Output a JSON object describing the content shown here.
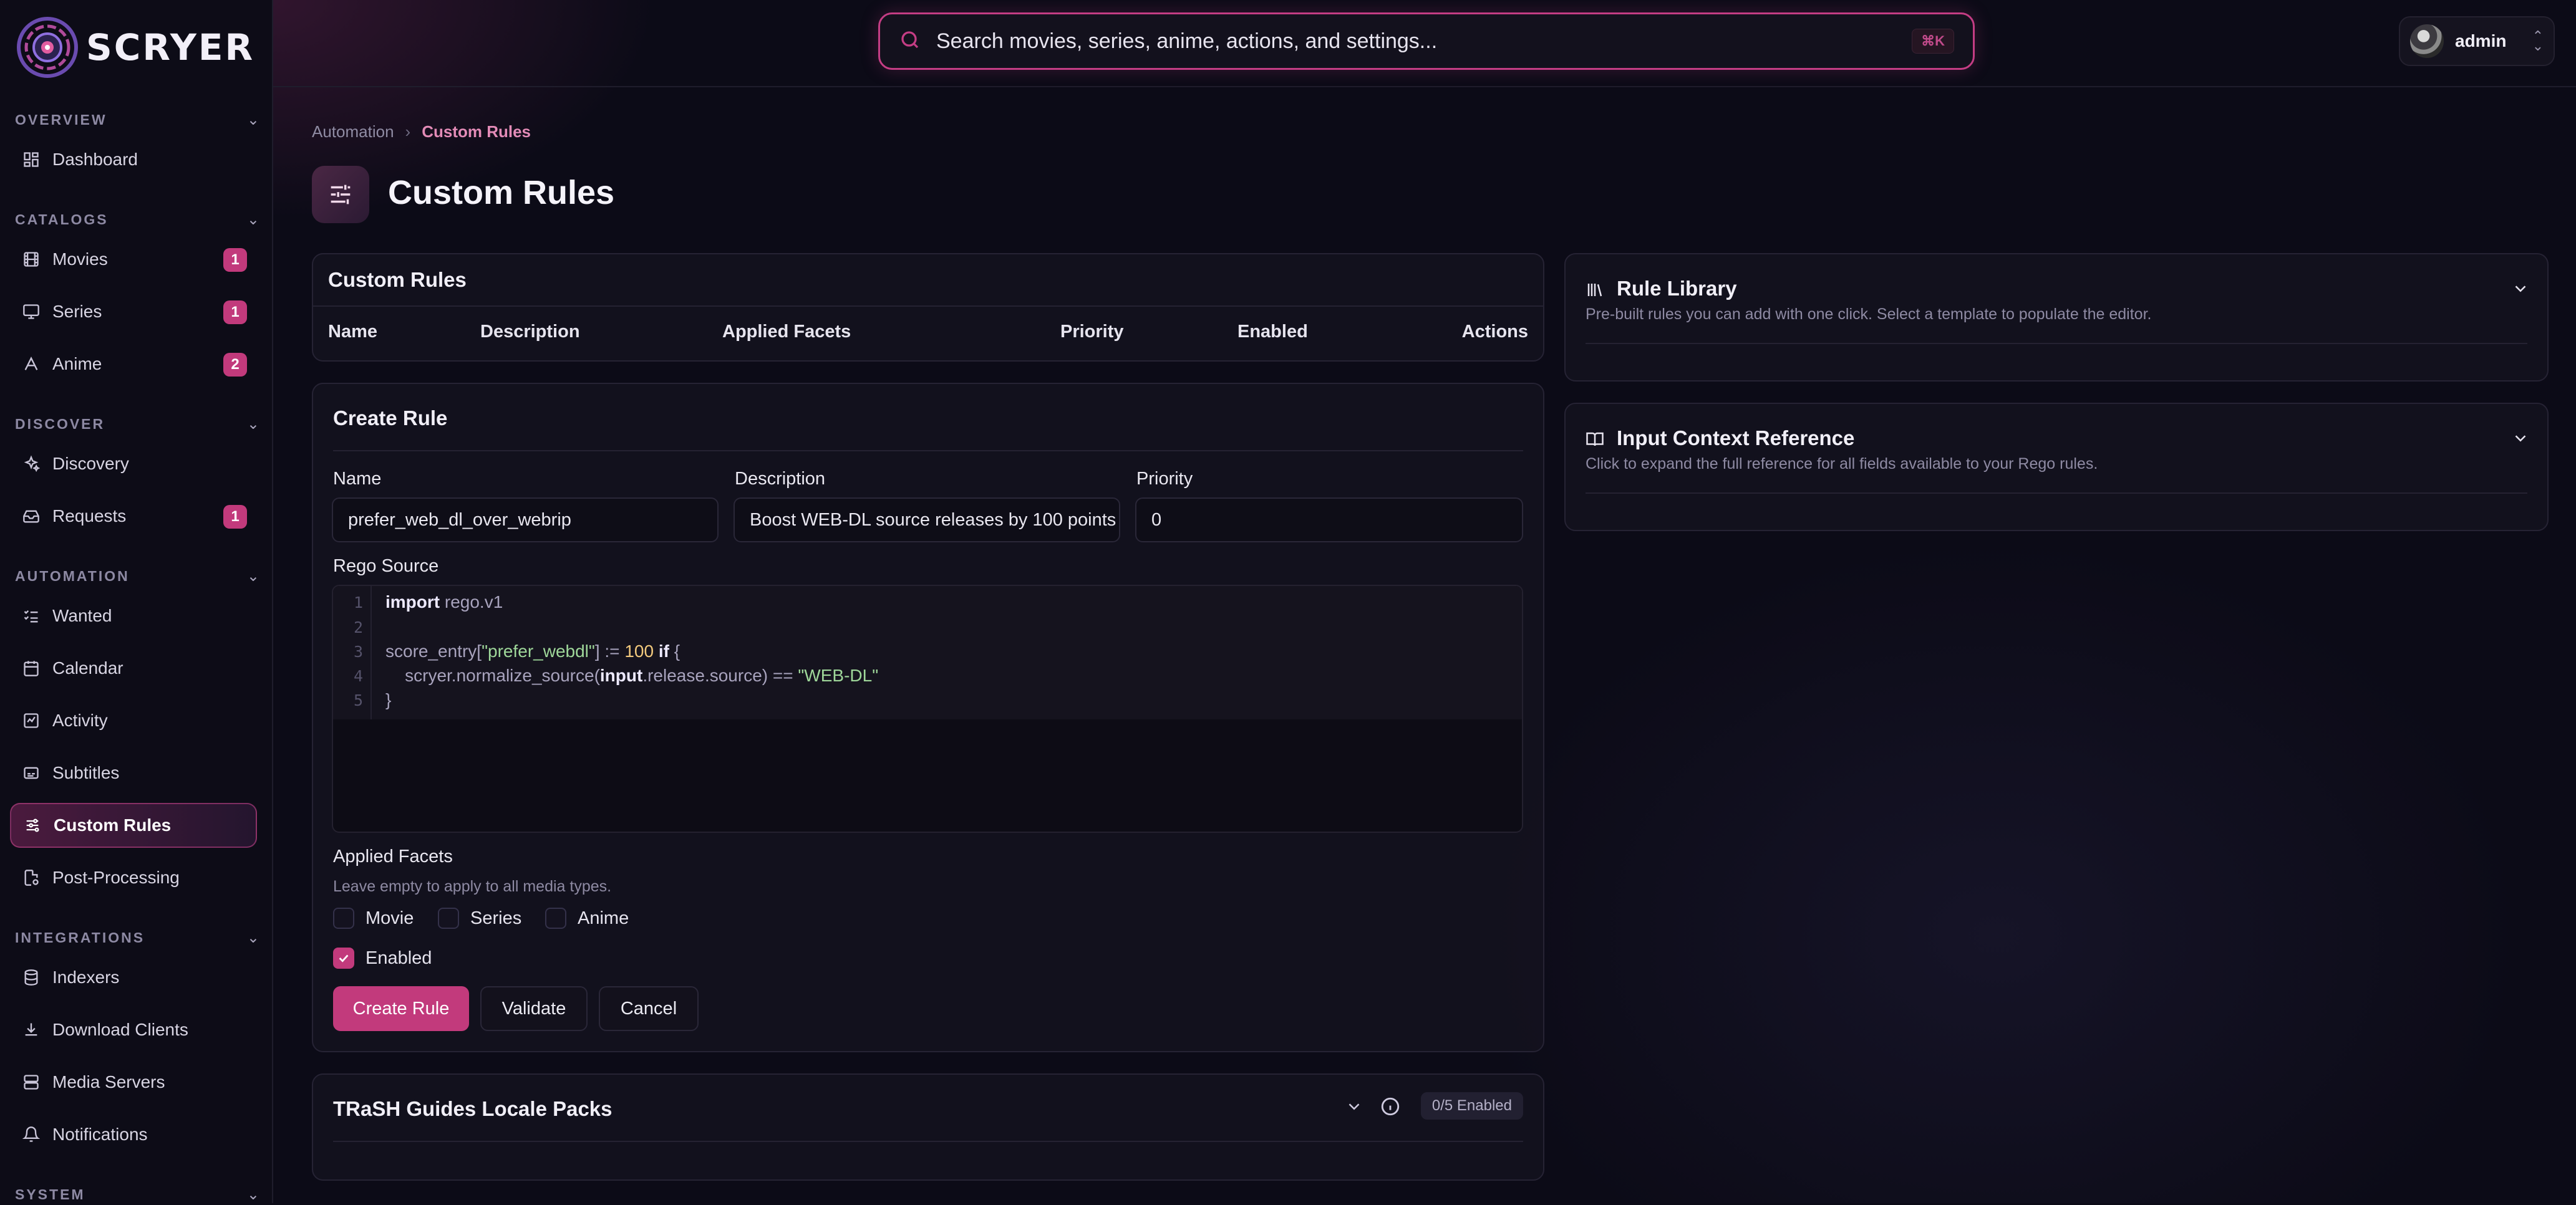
{
  "app": {
    "name": "SCRYER"
  },
  "sidebar": {
    "sections": [
      {
        "label": "OVERVIEW",
        "items": [
          {
            "label": "Dashboard",
            "icon": "dashboard-icon"
          }
        ]
      },
      {
        "label": "CATALOGS",
        "items": [
          {
            "label": "Movies",
            "icon": "film-icon",
            "badge": "1"
          },
          {
            "label": "Series",
            "icon": "monitor-icon",
            "badge": "1"
          },
          {
            "label": "Anime",
            "icon": "sparkle-icon",
            "badge": "2"
          }
        ]
      },
      {
        "label": "DISCOVER",
        "items": [
          {
            "label": "Discovery",
            "icon": "sparkles-icon"
          },
          {
            "label": "Requests",
            "icon": "inbox-icon",
            "badge": "1"
          }
        ]
      },
      {
        "label": "AUTOMATION",
        "items": [
          {
            "label": "Wanted",
            "icon": "list-check-icon"
          },
          {
            "label": "Calendar",
            "icon": "calendar-icon"
          },
          {
            "label": "Activity",
            "icon": "activity-icon"
          },
          {
            "label": "Subtitles",
            "icon": "subtitles-icon"
          },
          {
            "label": "Custom Rules",
            "icon": "sliders-icon",
            "active": true
          },
          {
            "label": "Post-Processing",
            "icon": "file-cog-icon"
          }
        ]
      },
      {
        "label": "INTEGRATIONS",
        "items": [
          {
            "label": "Indexers",
            "icon": "database-icon"
          },
          {
            "label": "Download Clients",
            "icon": "download-icon"
          },
          {
            "label": "Media Servers",
            "icon": "server-icon"
          },
          {
            "label": "Notifications",
            "icon": "bell-icon"
          }
        ]
      },
      {
        "label": "SYSTEM",
        "items": []
      }
    ]
  },
  "topbar": {
    "search_placeholder": "Search movies, series, anime, actions, and settings...",
    "shortcut": "⌘K",
    "user": "admin"
  },
  "breadcrumb": {
    "parent": "Automation",
    "current": "Custom Rules"
  },
  "page_title": "Custom Rules",
  "rules_table": {
    "title": "Custom Rules",
    "columns": [
      "Name",
      "Description",
      "Applied Facets",
      "Priority",
      "Enabled",
      "Actions"
    ],
    "rows": []
  },
  "create_rule": {
    "title": "Create Rule",
    "name_label": "Name",
    "name_value": "prefer_web_dl_over_webrip",
    "description_label": "Description",
    "description_value": "Boost WEB-DL source releases by 100 points",
    "priority_label": "Priority",
    "priority_value": "0",
    "rego_label": "Rego Source",
    "code_lines": [
      "import rego.v1",
      "",
      "score_entry[\"prefer_webdl\"] := 100 if {",
      "    scryer.normalize_source(input.release.source) == \"WEB-DL\"",
      "}"
    ],
    "facets_label": "Applied Facets",
    "facets_hint": "Leave empty to apply to all media types.",
    "facets": [
      {
        "label": "Movie",
        "checked": false
      },
      {
        "label": "Series",
        "checked": false
      },
      {
        "label": "Anime",
        "checked": false
      }
    ],
    "enabled_label": "Enabled",
    "enabled": true,
    "buttons": {
      "create": "Create Rule",
      "validate": "Validate",
      "cancel": "Cancel"
    }
  },
  "trash_packs": {
    "title": "TRaSH Guides Locale Packs",
    "status": "0/5 Enabled"
  },
  "rule_library": {
    "title": "Rule Library",
    "description": "Pre-built rules you can add with one click. Select a template to populate the editor."
  },
  "input_context": {
    "title": "Input Context Reference",
    "description": "Click to expand the full reference for all fields available to your Rego rules."
  },
  "colors": {
    "accent": "#c23a7c",
    "background": "#0c0b17",
    "card": "#14121e"
  }
}
